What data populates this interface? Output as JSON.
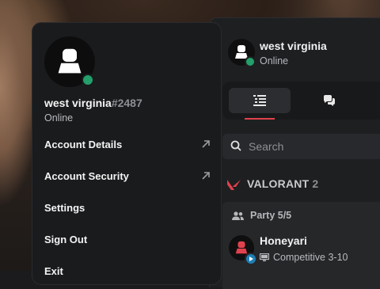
{
  "menu": {
    "username": "west virginia",
    "tag": "#2487",
    "status": "Online",
    "items": [
      {
        "label": "Account Details",
        "icon": "external-arrow-icon"
      },
      {
        "label": "Account Security",
        "icon": "external-arrow-icon"
      },
      {
        "label": "Settings"
      },
      {
        "label": "Sign Out"
      },
      {
        "label": "Exit"
      }
    ]
  },
  "social": {
    "username": "west virginia",
    "status": "Online",
    "tabs": [
      {
        "icon": "friends-list-icon"
      },
      {
        "icon": "chat-bubbles-icon"
      }
    ],
    "search": {
      "placeholder": "Search"
    },
    "game": {
      "label": "VALORANT",
      "count": "2"
    },
    "party": {
      "label": "Party 5/5",
      "members": [
        {
          "name": "Honeyari",
          "activity": "Competitive 3-10"
        }
      ]
    }
  },
  "colors": {
    "accent_red": "#e0424d",
    "online_green": "#23a06b",
    "panel_bg": "#1e1f21"
  }
}
